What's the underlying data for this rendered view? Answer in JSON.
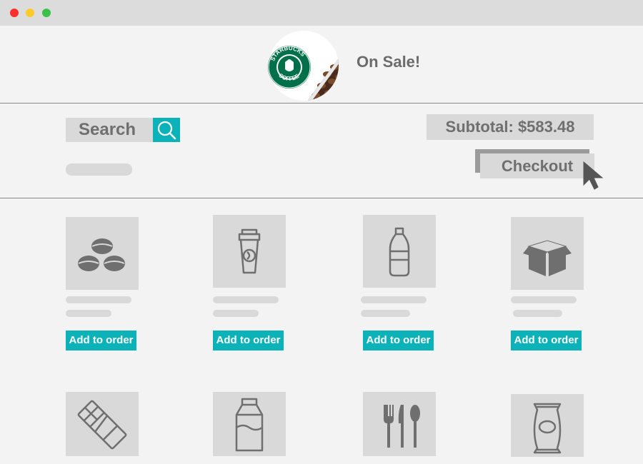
{
  "window": {
    "controls": [
      "close",
      "minimize",
      "maximize"
    ]
  },
  "header": {
    "logo_icon": "starbucks-coffee-logo",
    "logo_text_top": "STARBUCKS",
    "logo_text_bottom": "COFFEE",
    "sale_text": "On Sale!"
  },
  "toolbar": {
    "search_label": "Search",
    "search_icon": "magnifier-icon",
    "subtotal_text": "Subtotal: $583.48",
    "checkout_label": "Checkout"
  },
  "products": [
    {
      "icon": "coffee-beans-icon",
      "add_label": "Add to order"
    },
    {
      "icon": "coffee-cup-icon",
      "add_label": "Add to order"
    },
    {
      "icon": "water-bottle-icon",
      "add_label": "Add to order"
    },
    {
      "icon": "box-icon",
      "add_label": "Add to order"
    },
    {
      "icon": "chocolate-bar-icon"
    },
    {
      "icon": "milk-carton-icon"
    },
    {
      "icon": "cutlery-icon"
    },
    {
      "icon": "snack-bag-icon"
    }
  ],
  "colors": {
    "accent": "#0bb3b8",
    "tile": "#d9d9d9",
    "text": "#6f6f6f",
    "background": "#f3f3f3"
  }
}
